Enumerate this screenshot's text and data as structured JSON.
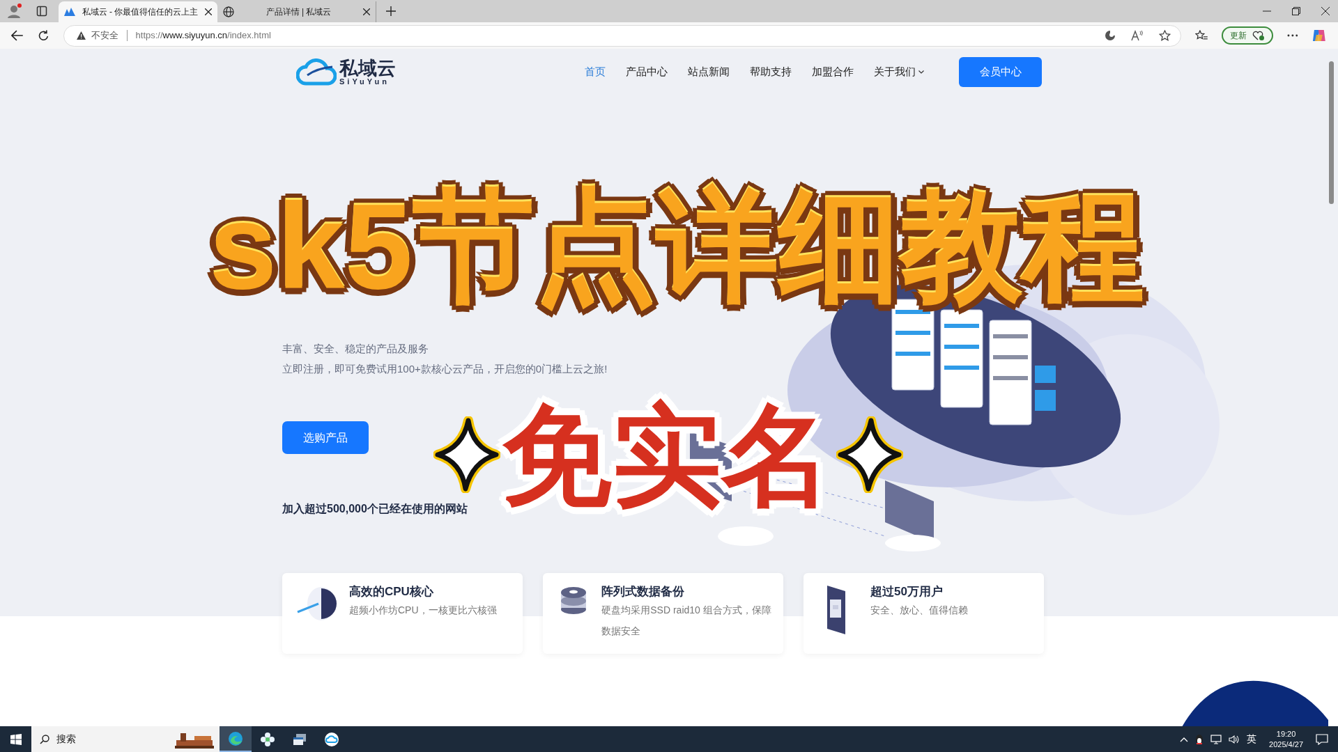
{
  "browser": {
    "tabs": [
      {
        "title": "私域云 - 你最值得信任的云上主",
        "selected": true
      },
      {
        "title": "产品详情 | 私域云",
        "selected": false
      }
    ],
    "address": {
      "security": "不安全",
      "url_scheme": "https://",
      "url_host": "www.siyuyun.cn",
      "url_path": "/index.html"
    },
    "update_button": "更新"
  },
  "site": {
    "logo": {
      "name": "私域云",
      "latin": "SiYuYun"
    },
    "nav": [
      {
        "label": "首页",
        "selected": true,
        "dropdown": false
      },
      {
        "label": "产品中心",
        "selected": false,
        "dropdown": false
      },
      {
        "label": "站点新闻",
        "selected": false,
        "dropdown": false
      },
      {
        "label": "帮助支持",
        "selected": false,
        "dropdown": false
      },
      {
        "label": "加盟合作",
        "selected": false,
        "dropdown": false
      },
      {
        "label": "关于我们",
        "selected": false,
        "dropdown": true
      }
    ],
    "member_button": "会员中心",
    "hero": {
      "subtitle": "丰富、安全、稳定的产品及服务",
      "description": "立即注册，即可免费试用100+款核心云产品，开启您的0门槛上云之旅!",
      "cta": "选购产品",
      "join_text": "加入超过500,000个已经在使用的网站"
    },
    "features": [
      {
        "kind": "chart",
        "title": "高效的CPU核心",
        "text": "超频小作坊CPU，一核更比六核强"
      },
      {
        "kind": "database",
        "title": "阵列式数据备份",
        "text": "硬盘均采用SSD raid10 组合方式，保障数据安全"
      },
      {
        "kind": "device",
        "title": "超过50万用户",
        "text": "安全、放心、值得信赖"
      }
    ]
  },
  "overlay": {
    "title": "sk5节点详细教程",
    "badge": "免实名"
  },
  "taskbar": {
    "search": "搜索",
    "ime": "英",
    "time": "19:20",
    "date": "2025/4/27"
  }
}
